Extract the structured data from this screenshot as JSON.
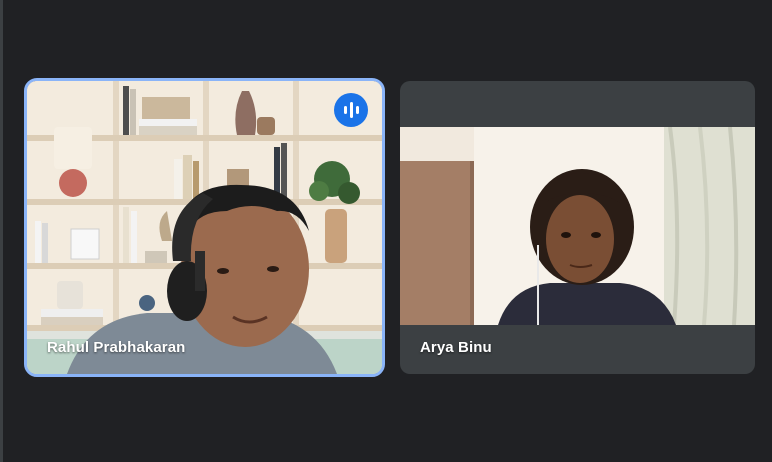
{
  "meeting": {
    "participants": [
      {
        "name": "Rahul Prabhakaran",
        "speaking": true,
        "highlight_color": "#8ab4f8",
        "indicator_color": "#1a73e8",
        "indicator_icon": "audio-wave-icon"
      },
      {
        "name": "Arya Binu",
        "speaking": false
      }
    ]
  },
  "theme": {
    "background": "#202124",
    "tile_background": "#3c4043",
    "label_color": "#ffffff"
  }
}
